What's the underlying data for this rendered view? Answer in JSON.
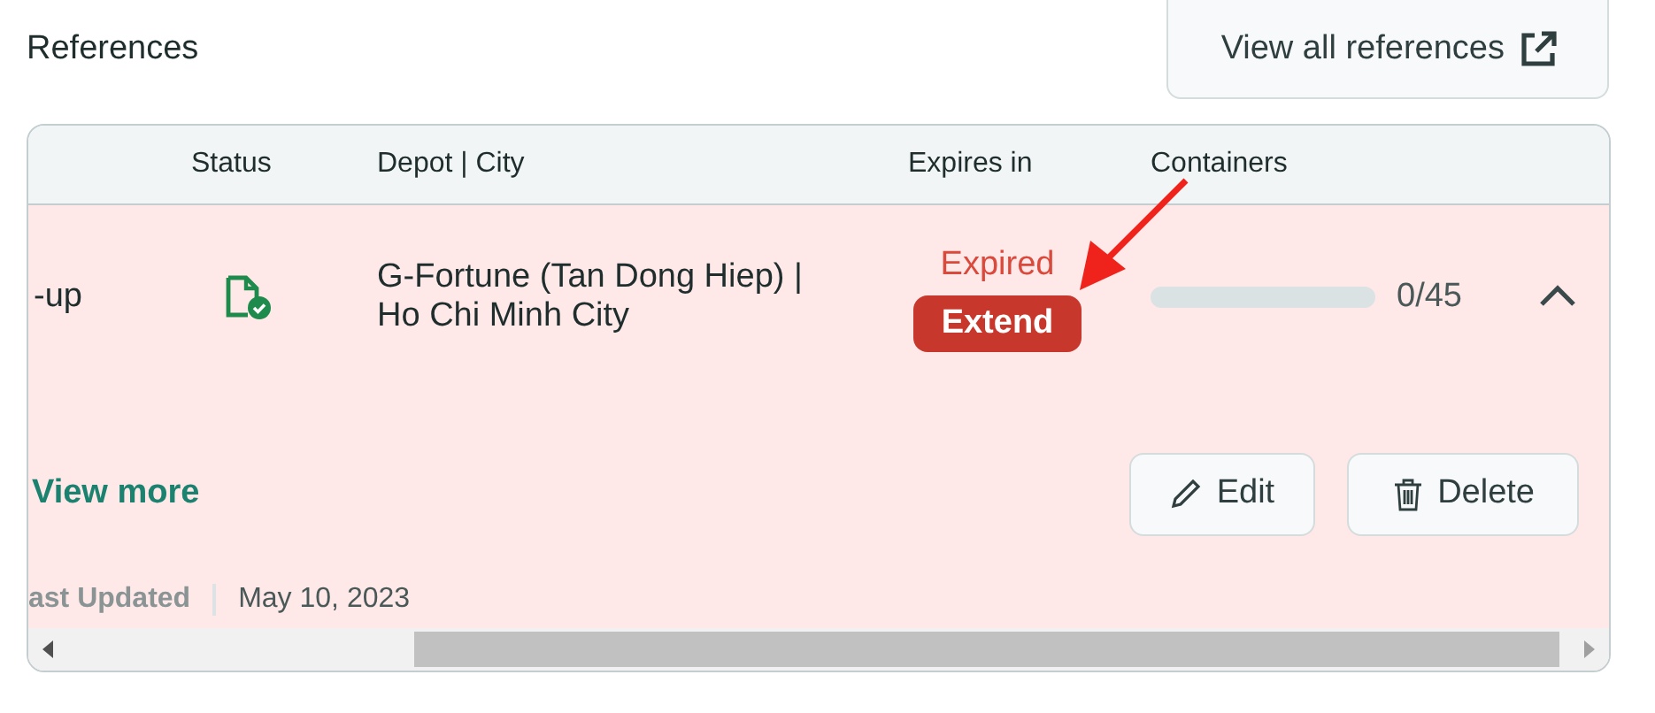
{
  "header": {
    "title": "References",
    "view_all_button": "View all references"
  },
  "table": {
    "columns": [
      "Status",
      "Depot | City",
      "Expires in",
      "Containers"
    ],
    "rows": [
      {
        "column_1": "-up",
        "kind": "confirmed",
        "depot": "G-Fortune (Tan Dong Hiep) | Ho Chi Minh City",
        "expires": "Expired",
        "extend_button": "Extend",
        "level": 0,
        "containers": "0/45",
        "expanded": true,
        "expired": true,
        "details": {
          "view_more": "View more",
          "edit_button": "Edit",
          "delete_button": "Delete",
          "updated_label": "ast Updated",
          "updated_value": "May 10, 2023"
        }
      }
    ]
  }
}
